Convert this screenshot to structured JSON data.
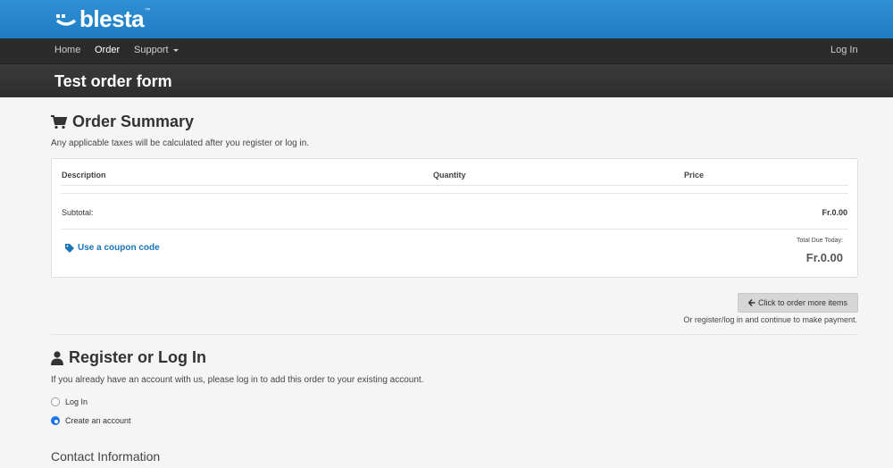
{
  "brand": {
    "name": "blesta",
    "tm": "™"
  },
  "nav": {
    "home": "Home",
    "order": "Order",
    "support": "Support",
    "login": "Log In"
  },
  "page": {
    "title": "Test order form"
  },
  "order_summary": {
    "heading": "Order Summary",
    "note": "Any applicable taxes will be calculated after you register or log in.",
    "columns": {
      "description": "Description",
      "quantity": "Quantity",
      "price": "Price"
    },
    "subtotal_label": "Subtotal:",
    "subtotal_value": "Fr.0.00",
    "coupon_link": "Use a coupon code",
    "total_due_label": "Total Due Today:",
    "total_due_value": "Fr.0.00"
  },
  "more_items": {
    "button": "Click to order more items",
    "note": "Or register/log in and continue to make payment."
  },
  "register": {
    "heading": "Register or Log In",
    "note": "If you already have an account with us, please log in to add this order to your existing account.",
    "options": [
      "Log In",
      "Create an account"
    ],
    "selected": "Create an account"
  },
  "contact": {
    "heading": "Contact Information"
  }
}
